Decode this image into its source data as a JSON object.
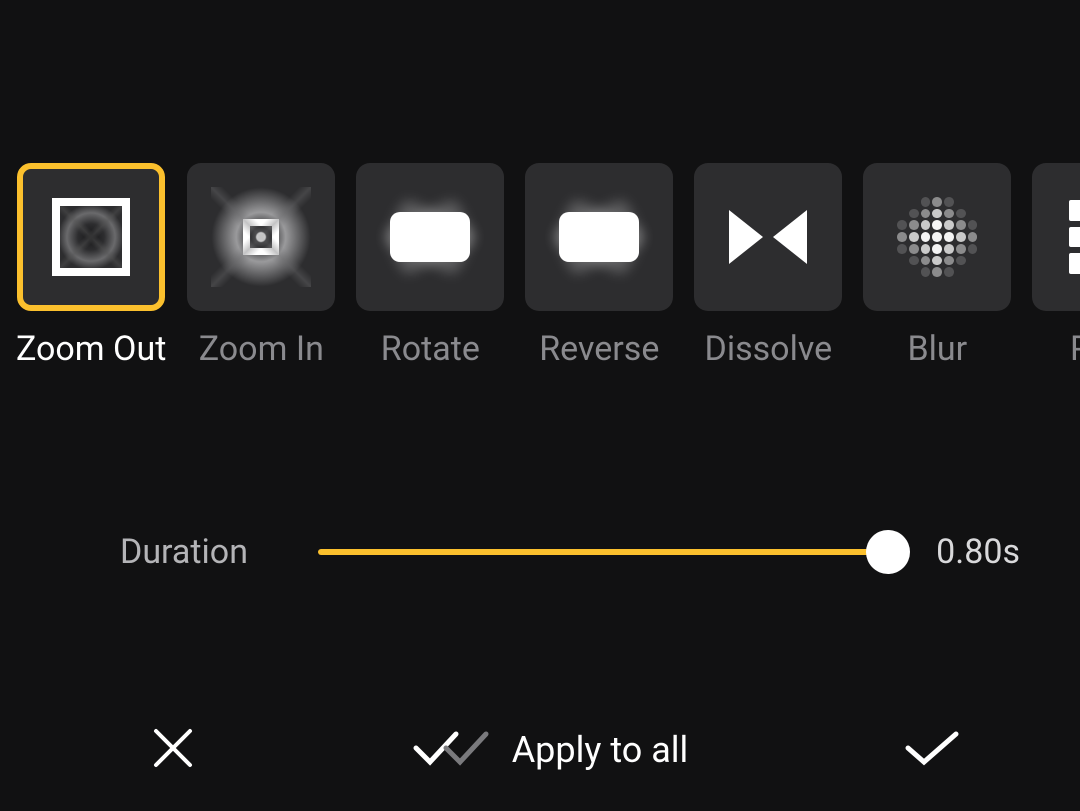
{
  "transitions": [
    {
      "id": "zoom-out",
      "label": "Zoom Out",
      "selected": true
    },
    {
      "id": "zoom-in",
      "label": "Zoom In",
      "selected": false
    },
    {
      "id": "rotate",
      "label": "Rotate",
      "selected": false
    },
    {
      "id": "reverse",
      "label": "Reverse",
      "selected": false
    },
    {
      "id": "dissolve",
      "label": "Dissolve",
      "selected": false
    },
    {
      "id": "blur",
      "label": "Blur",
      "selected": false
    },
    {
      "id": "pixel",
      "label": "Pixel",
      "selected": false
    }
  ],
  "slider": {
    "label": "Duration",
    "value_text": "0.80s",
    "value": 0.8,
    "min": 0.0,
    "max": 0.8,
    "fill_pct": 100
  },
  "actions": {
    "cancel_label": "",
    "apply_all_label": "Apply to all",
    "confirm_label": ""
  },
  "colors": {
    "accent": "#fbc02d",
    "bg": "#111112",
    "card": "#2d2d2f"
  }
}
